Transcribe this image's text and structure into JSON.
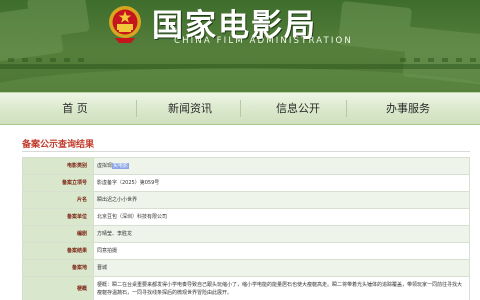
{
  "header": {
    "title": "国家电影局",
    "subtitle": "CHINA FILM ADMINISTRATION"
  },
  "nav": {
    "items": [
      "首 页",
      "新闻资讯",
      "信息公开",
      "办事服务"
    ]
  },
  "section": {
    "title": "备案公示查询结果"
  },
  "record": {
    "rows": [
      {
        "label": "电影类别",
        "value_prefix": "虚拟现",
        "value_highlight": "实电影"
      },
      {
        "label": "备案立项号",
        "value": "影虚备字（2025）第059号"
      },
      {
        "label": "片名",
        "value": "瞬出迟之小小世界"
      },
      {
        "label": "备案单位",
        "value": "北京豆包（深圳）科技有限公司"
      },
      {
        "label": "编剧",
        "value": "方晴莹、李胜龙"
      },
      {
        "label": "备案结果",
        "value": "同意拍摄"
      },
      {
        "label": "备案地",
        "value": "晋城"
      },
      {
        "label": "梗概",
        "value": "梗概：瞬二在台桌重要来都发得小学电奏导致自己跟头玩缩小了，缩小学电能的能量居石也使大瘦躯高走。瞬二将带着光头锤体的追踪覆盖，带领玩家一同前往寻找大瘦躯存温蔬石，一同寻找线条探后的微观世界冒险由此展开。"
      }
    ]
  },
  "colors": {
    "header_green": "#4c7533",
    "section_title_red": "#c0392b",
    "label_bg": "#d9e7cc",
    "label_text": "#7a1f10"
  }
}
